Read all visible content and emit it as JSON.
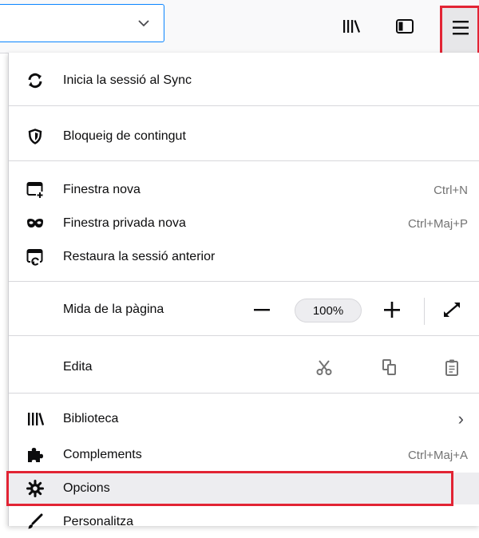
{
  "toolbar": {
    "urlbar_dropdown_icon": "chevron-down-icon",
    "library_icon": "library-icon",
    "sidebar_icon": "sidebar-icon",
    "menu_icon": "hamburger-menu-icon"
  },
  "menu": {
    "sync": {
      "label": "Inicia la sessió al Sync",
      "icon": "sync-icon"
    },
    "content_blocking": {
      "label": "Bloqueig de contingut",
      "icon": "shield-icon"
    },
    "new_window": {
      "label": "Finestra nova",
      "shortcut": "Ctrl+N",
      "icon": "new-window-icon"
    },
    "private_window": {
      "label": "Finestra privada nova",
      "shortcut": "Ctrl+Maj+P",
      "icon": "private-mask-icon"
    },
    "restore_session": {
      "label": "Restaura la sessió anterior",
      "icon": "restore-session-icon"
    },
    "zoom": {
      "label": "Mida de la pàgina",
      "value": "100%",
      "minus": "−",
      "plus": "+"
    },
    "edit": {
      "label": "Edita",
      "cut_icon": "scissors-icon",
      "copy_icon": "copy-icon",
      "paste_icon": "paste-icon"
    },
    "library": {
      "label": "Biblioteca",
      "chevron": "›",
      "icon": "library-icon"
    },
    "addons": {
      "label": "Complements",
      "shortcut": "Ctrl+Maj+A",
      "icon": "puzzle-icon"
    },
    "options": {
      "label": "Opcions",
      "icon": "gear-icon"
    },
    "customize": {
      "label": "Personalitza",
      "icon": "paintbrush-icon"
    }
  },
  "colors": {
    "highlight": "#e22434",
    "focus_blue": "#0a84ff"
  }
}
